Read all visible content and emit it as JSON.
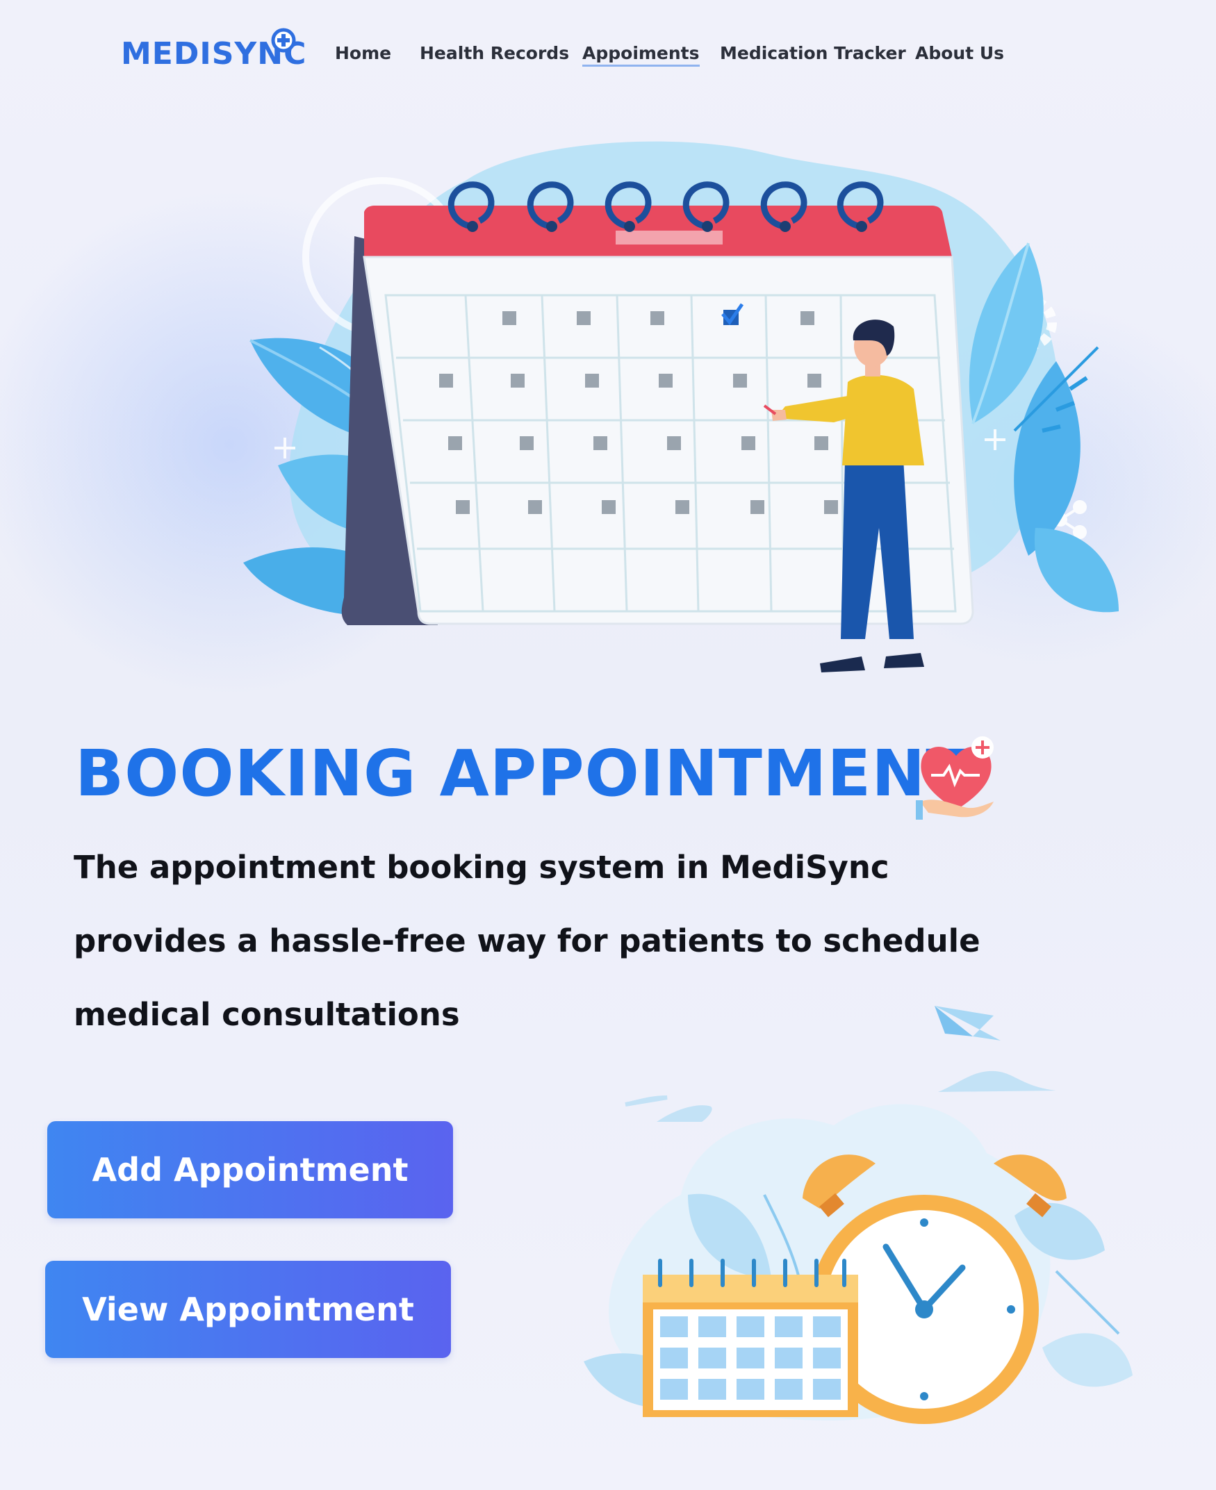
{
  "brand": {
    "name": "MEDISYNC",
    "logo_badge": "plus-circle"
  },
  "nav": {
    "items": [
      {
        "label": "Home"
      },
      {
        "label": "Health Records"
      },
      {
        "label": "Appoiments",
        "active": true
      },
      {
        "label": "Medication Tracker"
      },
      {
        "label": "About Us"
      }
    ]
  },
  "hero": {
    "illustration": "calendar-planning-illustration",
    "headline": "BOOKING APPOINTMENT",
    "headline_icon": "heart-care-icon",
    "description_lines": [
      "The appointment booking system in MediSync",
      "provides a hassle-free way for patients to schedule",
      "medical consultations"
    ]
  },
  "actions": {
    "add_label": "Add Appointment",
    "view_label": "View Appointment"
  },
  "secondary_illustration": "calendar-alarm-clock-illustration",
  "colors": {
    "brand_blue": "#2f6fe0",
    "headline_blue": "#1f72e8",
    "button_gradient_start": "#3f86f1",
    "button_gradient_end": "#5a63ef",
    "calendar_red": "#e84a5f",
    "background": "#eef0fa"
  }
}
